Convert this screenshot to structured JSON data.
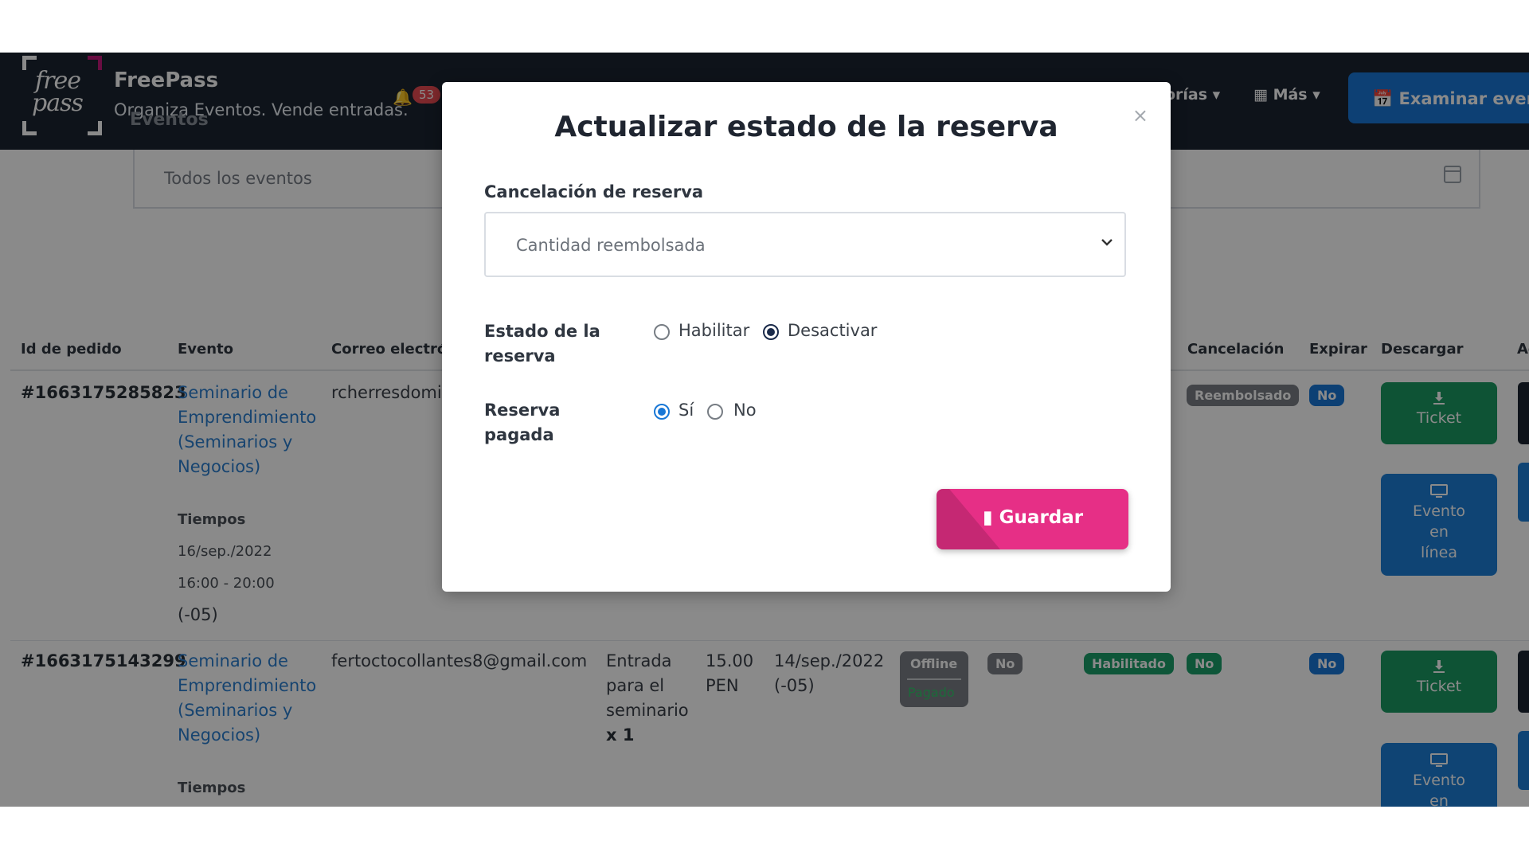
{
  "header": {
    "brand_name": "FreePass",
    "brand_tagline": "Organiza Eventos. Vende entradas.",
    "logo_top": "free",
    "logo_bottom": "pass",
    "notification_count": "53",
    "nav_categories": "orías ▾",
    "nav_more": "Más ▾",
    "explore_button": "Examinar event"
  },
  "filters": {
    "events_label": "Eventos",
    "events_select": "Todos los eventos"
  },
  "table": {
    "columns": [
      "Id de pedido",
      "Evento",
      "Correo electrón",
      "Cancelación",
      "Expirar",
      "Descargar",
      "Ac"
    ],
    "rows": [
      {
        "order_id": "#1663175285823",
        "event_lines": [
          "Seminario de",
          "Emprendimiento",
          "(Seminarios y",
          "Negocios)"
        ],
        "email": "rcherresdomi",
        "times_label": "Tiempos",
        "date": "16/sep./2022",
        "time_range": "16:00 - 20:00",
        "tz": "(-05)",
        "cancellation_badge": "Reembolsado",
        "expire_badge": "No",
        "ticket_button": "Ticket",
        "online_lines": [
          "Evento",
          "en",
          "línea"
        ]
      },
      {
        "order_id": "#1663175143299",
        "event_lines": [
          "Seminario de",
          "Emprendimiento",
          "(Seminarios y",
          "Negocios)"
        ],
        "email": "fertoctocollantes8@gmail.com",
        "ticket_lines": [
          "Entrada",
          "para el",
          "seminario"
        ],
        "ticket_qty": "x 1",
        "price_lines": [
          "15.00",
          "PEN"
        ],
        "created_lines": [
          "14/sep./2022",
          "(-05)"
        ],
        "payment_top": "Offline",
        "payment_bottom": "Pagado",
        "badge_no_1": "No",
        "status_badge": "Habilitado",
        "cancellation_badge": "No",
        "expire_badge": "No",
        "times_label": "Tiempos",
        "ticket_button": "Ticket",
        "online_lines": [
          "Evento",
          "en"
        ]
      }
    ]
  },
  "modal": {
    "title": "Actualizar estado de la reserva",
    "close": "×",
    "cancel_label": "Cancelación de reserva",
    "cancel_select_value": "Cantidad reembolsada",
    "status_label_lines": [
      "Estado de la",
      "reserva"
    ],
    "status_options": [
      "Habilitar",
      "Desactivar"
    ],
    "status_selected": "Desactivar",
    "paid_label_lines": [
      "Reserva",
      "pagada"
    ],
    "paid_options": [
      "Sí",
      "No"
    ],
    "paid_selected": "Sí",
    "save_button": "Guardar"
  },
  "colors": {
    "header_bg": "#1b2431",
    "accent_blue": "#1877d6",
    "save_pink": "#e62f86",
    "ticket_green": "#1b9a62",
    "logo_accent": "#c2187b"
  }
}
